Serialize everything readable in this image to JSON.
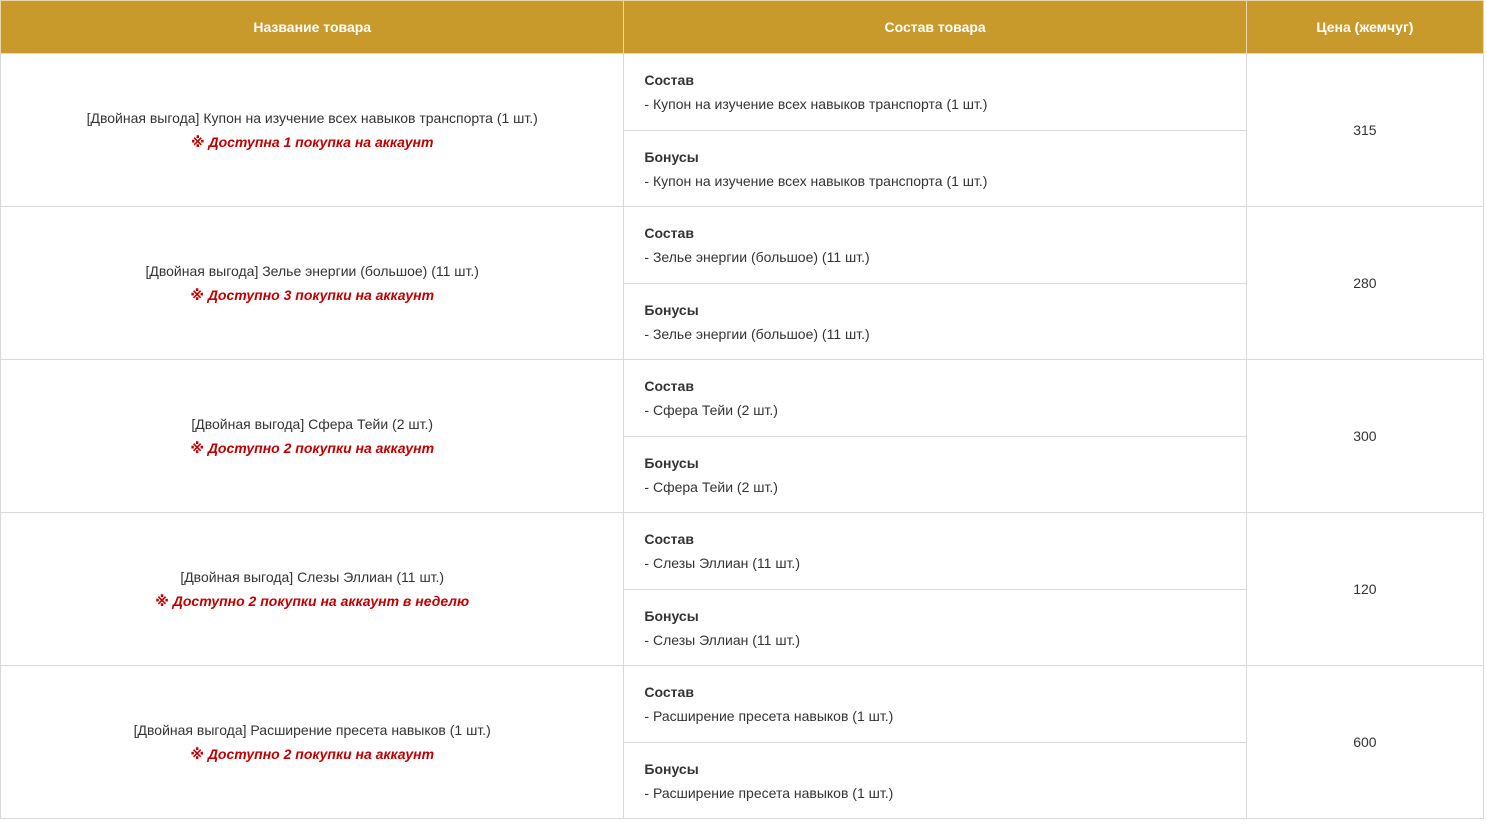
{
  "header": {
    "name": "Название товара",
    "composition": "Состав товара",
    "price": "Цена (жемчуг)"
  },
  "rows": [
    {
      "name": "[Двойная выгода] Купон на изучение всех навыков транспорта (1 шт.)",
      "limit": "※ Доступна 1 покупка на аккаунт",
      "contents_title": "Состав",
      "contents_item": "- Купон на изучение всех навыков транспорта (1 шт.)",
      "bonus_title": "Бонусы",
      "bonus_item": "- Купон на изучение всех навыков транспорта (1 шт.)",
      "price": "315"
    },
    {
      "name": "[Двойная выгода] Зелье энергии (большое) (11 шт.)",
      "limit": "※ Доступно 3 покупки на аккаунт",
      "contents_title": "Состав",
      "contents_item": "- Зелье энергии (большое) (11 шт.)",
      "bonus_title": "Бонусы",
      "bonus_item": "- Зелье энергии (большое) (11 шт.)",
      "price": "280"
    },
    {
      "name": "[Двойная выгода] Сфера Тейи (2 шт.)",
      "limit": "※ Доступно 2 покупки на аккаунт",
      "contents_title": "Состав",
      "contents_item": "- Сфера Тейи (2 шт.)",
      "bonus_title": "Бонусы",
      "bonus_item": "- Сфера Тейи (2 шт.)",
      "price": "300"
    },
    {
      "name": "[Двойная выгода] Слезы Эллиан (11 шт.)",
      "limit": "※ Доступно 2 покупки на аккаунт в неделю",
      "contents_title": "Состав",
      "contents_item": "- Слезы Эллиан (11 шт.)",
      "bonus_title": "Бонусы",
      "bonus_item": "- Слезы Эллиан (11 шт.)",
      "price": "120"
    },
    {
      "name": "[Двойная выгода] Расширение пресета навыков (1 шт.)",
      "limit": "※ Доступно 2 покупки на аккаунт",
      "contents_title": "Состав",
      "contents_item": "- Расширение пресета навыков (1 шт.)",
      "bonus_title": "Бонусы",
      "bonus_item": "- Расширение пресета навыков (1 шт.)",
      "price": "600"
    }
  ],
  "colors": {
    "header_bg": "#c89a2b",
    "limit_text": "#c00000",
    "border": "#d9d9d9"
  }
}
